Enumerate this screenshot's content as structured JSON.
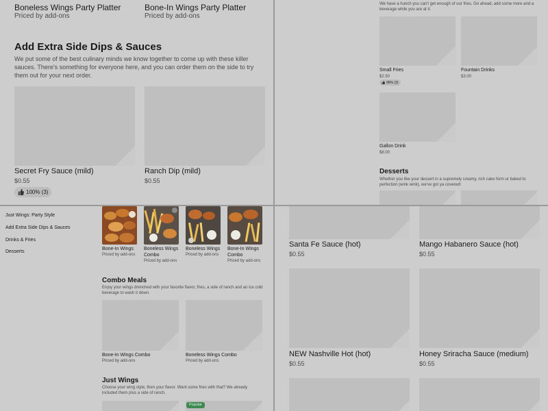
{
  "tl": {
    "top_items": [
      {
        "name": "Boneless Wings Party Platter",
        "price": "Priced by add-ons"
      },
      {
        "name": "Bone-In Wings Party Platter",
        "price": "Priced by add-ons"
      }
    ],
    "section_title": "Add Extra Side Dips & Sauces",
    "section_desc": "We put some of the best culinary minds we know together to come up with these killer sauces. There's something for everyone here, and you can order them on the side to try them out for your next order.",
    "items": [
      {
        "name": "Secret Fry Sauce (mild)",
        "price": "$0.55",
        "rating": "100% (3)"
      },
      {
        "name": "Ranch Dip (mild)",
        "price": "$0.55"
      }
    ]
  },
  "tr": {
    "section_desc": "We have a hunch you can't get enough of our fries. Go ahead, add some more and a beverage while you are at it.",
    "items": [
      {
        "name": "Small Fries",
        "price": "$2.50",
        "rating": "96% (3)"
      },
      {
        "name": "Fountain Drinks",
        "price": "$3.00"
      },
      {
        "name": "Gallon Drink",
        "price": "$8.00"
      }
    ],
    "desserts_title": "Desserts",
    "desserts_desc": "Whether you like your dessert in a supremely creamy, rich cake form or baked to perfection (wink wink), we've got ya covered!"
  },
  "bl": {
    "nav": [
      "Just Wings: Party Style",
      "Add Extra Side Dips & Sauces",
      "Drinks & Fries",
      "Desserts"
    ],
    "featured": [
      {
        "name": "Bone-In Wings",
        "price": "Priced by add-ons"
      },
      {
        "name": "Boneless Wings Combo",
        "price": "Priced by add-ons"
      },
      {
        "name": "Boneless Wings",
        "price": "Priced by add-ons"
      },
      {
        "name": "Bone-In Wings Combo",
        "price": "Priced by add-ons"
      }
    ],
    "combo_title": "Combo Meals",
    "combo_desc": "Enjoy your wings drenched with your favorite flavor, fries, a side of ranch and an ice cold beverage to wash it down.",
    "combo_items": [
      {
        "name": "Bone-In Wings Combo",
        "price": "Priced by add-ons"
      },
      {
        "name": "Boneless Wings Combo",
        "price": "Priced by add-ons"
      }
    ],
    "wings_title": "Just Wings",
    "wings_desc": "Choose your wing style, then your flavor. Want some fries with that? We already included them plus a side of ranch.",
    "popular_label": "Popular"
  },
  "br": {
    "items": [
      {
        "name": "Santa Fe Sauce (hot)",
        "price": "$0.55"
      },
      {
        "name": "Mango Habanero Sauce (hot)",
        "price": "$0.55"
      },
      {
        "name": "NEW Nashville Hot (hot)",
        "price": "$0.55"
      },
      {
        "name": "Honey Sriracha Sauce (medium)",
        "price": "$0.55"
      }
    ]
  },
  "colors": {
    "popular": "#3f8a52",
    "overlay": "#cdcdcd",
    "placeholder": "#bfbfbf"
  },
  "icons": {
    "rating": "thumbs-up-icon"
  }
}
